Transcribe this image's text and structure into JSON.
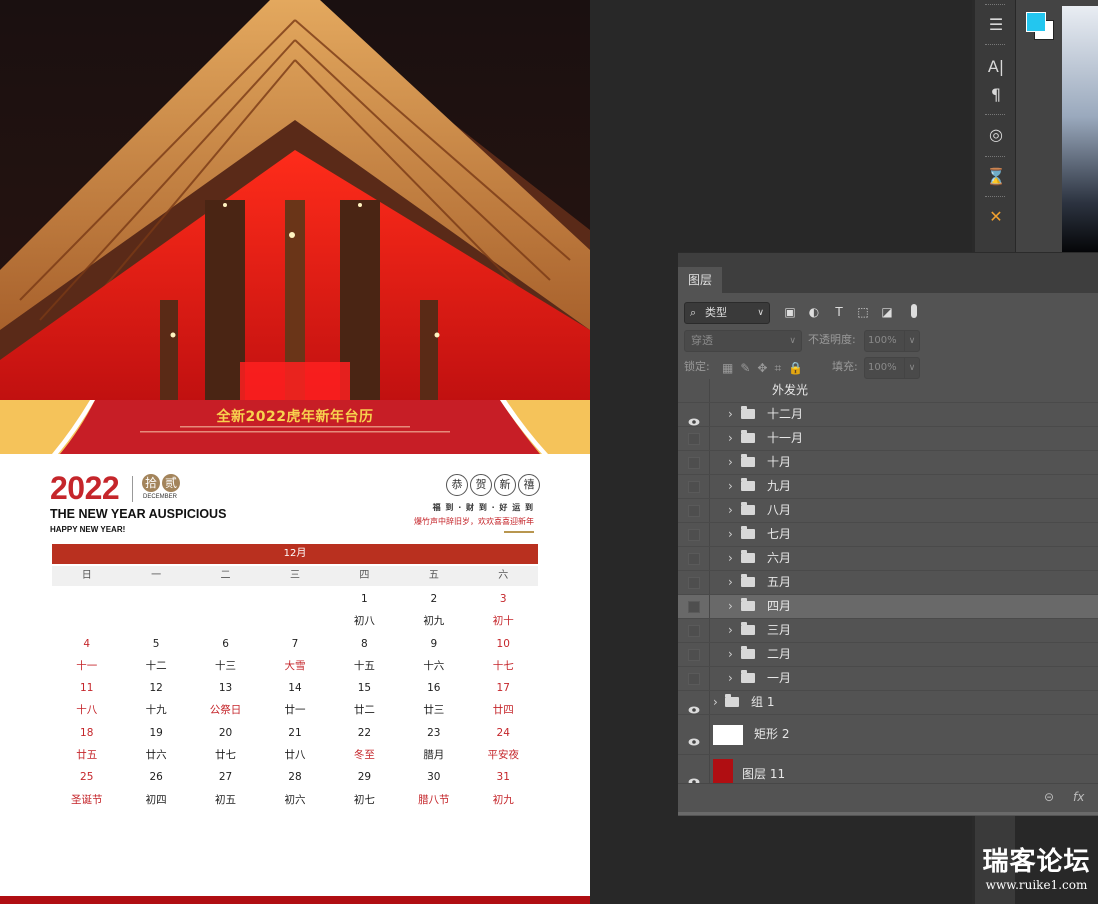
{
  "calendar": {
    "banner_title": "全新2022虎年新年台历",
    "year": "2022",
    "seal_chars": [
      "拾",
      "贰"
    ],
    "month_en": "DECEMBER",
    "slogan": "THE NEW YEAR AUSPICIOUS",
    "happy": "HAPPY NEW YEAR!",
    "greeting_chars": [
      "恭",
      "贺",
      "新",
      "禧"
    ],
    "blessing": "福 到 · 财 到 · 好 运 到",
    "small_line": "爆竹声中辞旧岁，欢欢喜喜迎新年",
    "month_label": "12月",
    "weekdays": [
      "日",
      "一",
      "二",
      "三",
      "四",
      "五",
      "六"
    ],
    "rows": [
      [
        "",
        "",
        "",
        "",
        "1",
        "2",
        "3"
      ],
      [
        "",
        "",
        "",
        "",
        "初八",
        "初九",
        "初十"
      ],
      [
        "4",
        "5",
        "6",
        "7",
        "8",
        "9",
        "10"
      ],
      [
        "十一",
        "十二",
        "十三",
        "大雪",
        "十五",
        "十六",
        "十七"
      ],
      [
        "11",
        "12",
        "13",
        "14",
        "15",
        "16",
        "17"
      ],
      [
        "十八",
        "十九",
        "公祭日",
        "廿一",
        "廿二",
        "廿三",
        "廿四"
      ],
      [
        "18",
        "19",
        "20",
        "21",
        "22",
        "23",
        "24"
      ],
      [
        "廿五",
        "廿六",
        "廿七",
        "廿八",
        "冬至",
        "腊月",
        "平安夜"
      ],
      [
        "25",
        "26",
        "27",
        "28",
        "29",
        "30",
        "31"
      ],
      [
        "圣诞节",
        "初四",
        "初五",
        "初六",
        "初七",
        "腊八节",
        "初九"
      ]
    ],
    "red_cells": [
      [
        0,
        6
      ],
      [
        1,
        6
      ],
      [
        2,
        0
      ],
      [
        2,
        6
      ],
      [
        3,
        0
      ],
      [
        3,
        3
      ],
      [
        3,
        6
      ],
      [
        4,
        0
      ],
      [
        4,
        6
      ],
      [
        5,
        0
      ],
      [
        5,
        2
      ],
      [
        5,
        6
      ],
      [
        6,
        0
      ],
      [
        6,
        6
      ],
      [
        7,
        0
      ],
      [
        7,
        4
      ],
      [
        7,
        6
      ],
      [
        8,
        0
      ],
      [
        8,
        6
      ],
      [
        9,
        0
      ],
      [
        9,
        5
      ],
      [
        9,
        6
      ]
    ]
  },
  "layers_panel": {
    "tab": "图层",
    "filter_label": "类型",
    "blend_mode": "穿透",
    "opacity_label": "不透明度:",
    "opacity_value": "100%",
    "lock_label": "锁定:",
    "fill_label": "填充:",
    "fill_value": "100%",
    "effect_label": "外发光",
    "month_groups": [
      {
        "name": "十二月",
        "visible": true,
        "selected": false
      },
      {
        "name": "十一月",
        "visible": false,
        "selected": false
      },
      {
        "name": "十月",
        "visible": false,
        "selected": false
      },
      {
        "name": "九月",
        "visible": false,
        "selected": false
      },
      {
        "name": "八月",
        "visible": false,
        "selected": false
      },
      {
        "name": "七月",
        "visible": false,
        "selected": false
      },
      {
        "name": "六月",
        "visible": false,
        "selected": false
      },
      {
        "name": "五月",
        "visible": false,
        "selected": false
      },
      {
        "name": "四月",
        "visible": false,
        "selected": true
      },
      {
        "name": "三月",
        "visible": false,
        "selected": false
      },
      {
        "name": "二月",
        "visible": false,
        "selected": false
      },
      {
        "name": "一月",
        "visible": false,
        "selected": false
      }
    ],
    "group1": "组 1",
    "shape_layer": "矩形 2",
    "pixel_layer": "图层 11",
    "fx_label": "fx"
  },
  "colors": {
    "foreground": "#23c6ef",
    "background": "#ffffff",
    "calendar_red": "#c5262b",
    "layer_thumb_red": "#b00e12"
  },
  "watermark": {
    "title": "瑞客论坛",
    "url": "www.ruike1.com"
  }
}
